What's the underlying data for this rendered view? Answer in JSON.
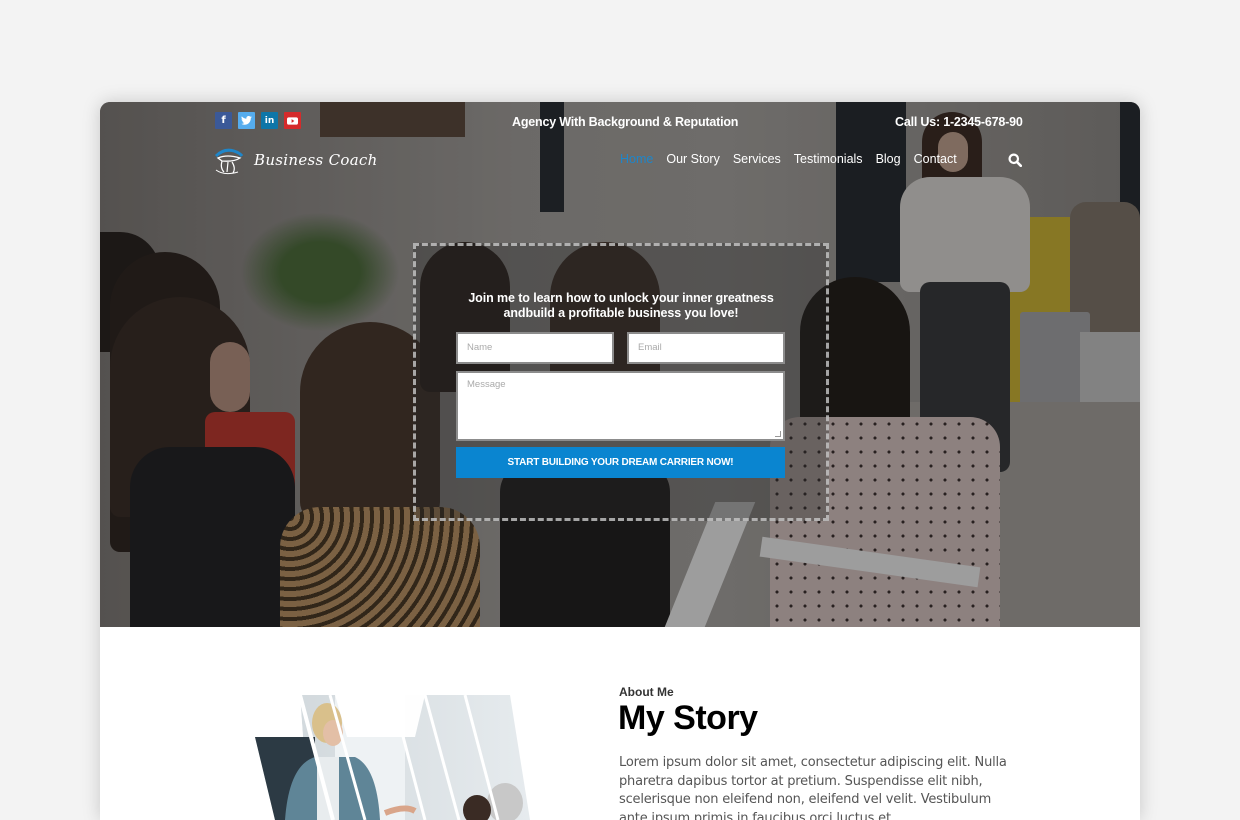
{
  "topbar": {
    "social_icons": [
      {
        "name": "facebook-icon",
        "glyph": "f"
      },
      {
        "name": "twitter-icon",
        "glyph": "t"
      },
      {
        "name": "linkedin-icon",
        "glyph": "in"
      },
      {
        "name": "youtube-icon",
        "glyph": "▶"
      }
    ],
    "tagline": "Agency With Background & Reputation",
    "phone": "Call Us: 1-2345-678-90"
  },
  "logo": {
    "text": "Business Coach"
  },
  "nav": {
    "items": [
      {
        "label": "Home",
        "active": true
      },
      {
        "label": "Our Story",
        "active": false
      },
      {
        "label": "Services",
        "active": false
      },
      {
        "label": "Testimonials",
        "active": false
      },
      {
        "label": "Blog",
        "active": false
      },
      {
        "label": "Contact",
        "active": false
      }
    ]
  },
  "hero_form": {
    "title_line1": "Join me to learn how to unlock your inner greatness",
    "title_line2": "andbuild a profitable business you love!",
    "name_placeholder": "Name",
    "email_placeholder": "Email",
    "message_placeholder": "Message",
    "submit_label": "START BUILDING YOUR DREAM CARRIER NOW!"
  },
  "about": {
    "label": "About Me",
    "title": "My Story",
    "body": "Lorem ipsum dolor sit amet, consectetur adipiscing elit. Nulla pharetra dapibus tortor at pretium. Suspendisse elit nibh, scelerisque non eleifend non, eleifend vel velit. Vestibulum ante ipsum primis in faucibus orci luctus et"
  },
  "colors": {
    "accent": "#0a85d0",
    "nav_active": "#1f86c9",
    "page_bg": "#f3f3f3"
  }
}
